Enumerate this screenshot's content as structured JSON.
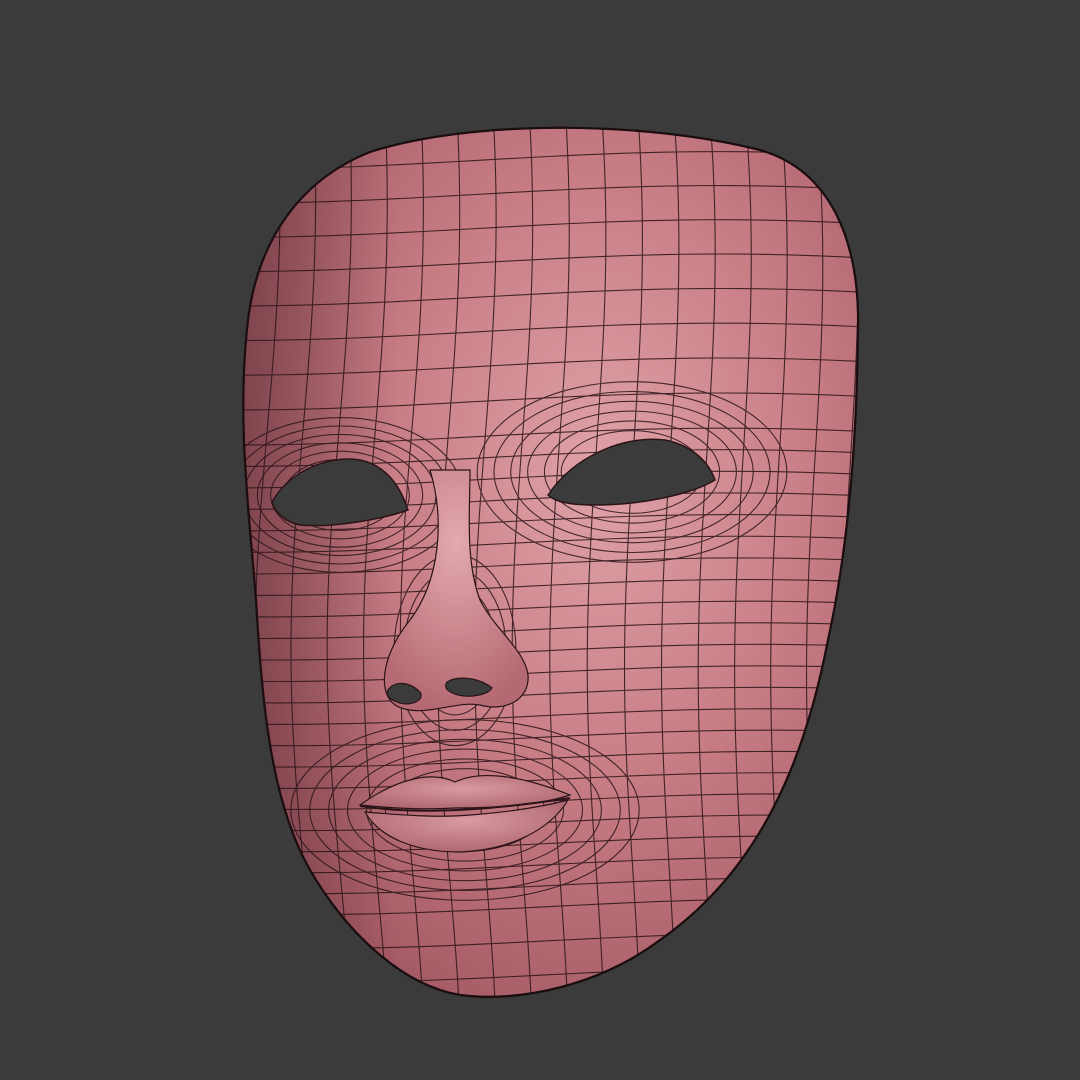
{
  "scene": {
    "subject": "mask-3d-model",
    "display_mode": "shaded-with-wireframe",
    "colors": {
      "background": "#3b3b3b",
      "surface": "#c97e86",
      "surface_highlight": "#dea0a6",
      "surface_shadow": "#8e4f58",
      "wireframe": "#2a1418",
      "holes": "#3b3b3b"
    }
  }
}
